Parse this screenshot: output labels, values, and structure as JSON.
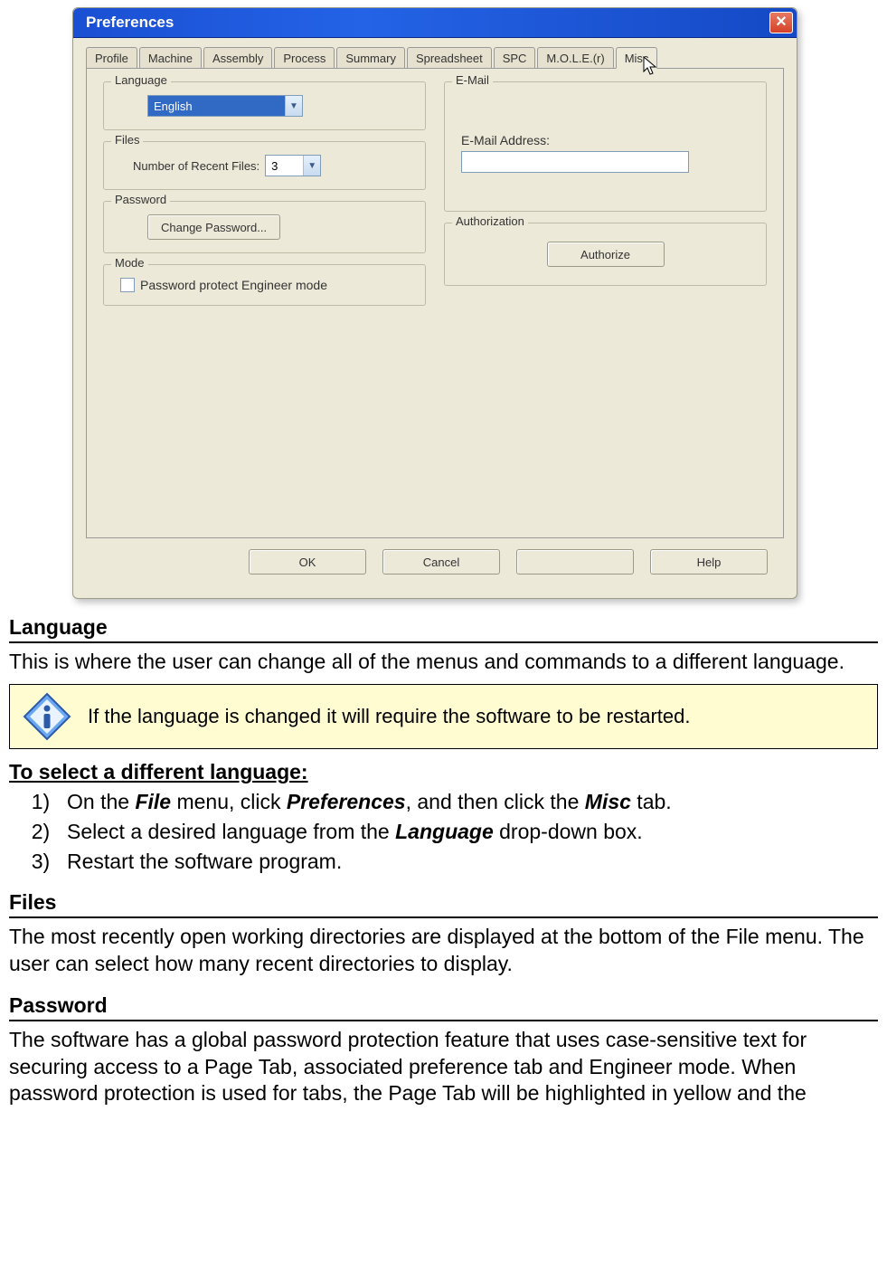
{
  "dialog": {
    "title": "Preferences",
    "tabs": [
      "Profile",
      "Machine",
      "Assembly",
      "Process",
      "Summary",
      "Spreadsheet",
      "SPC",
      "M.O.L.E.(r)",
      "Misc"
    ],
    "active_tab_index": 8,
    "language_group": "Language",
    "language_value": "English",
    "files_group": "Files",
    "files_label": "Number of Recent Files:",
    "files_value": "3",
    "password_group": "Password",
    "change_password_btn": "Change Password...",
    "mode_group": "Mode",
    "mode_checkbox_label": "Password protect Engineer mode",
    "email_group": "E-Mail",
    "email_label": "E-Mail Address:",
    "auth_group": "Authorization",
    "authorize_btn": "Authorize",
    "buttons": {
      "ok": "OK",
      "cancel": "Cancel",
      "apply": "",
      "help": "Help"
    }
  },
  "doc": {
    "h1": "Language",
    "p1": "This is where the user can change all of the menus and commands to a different language.",
    "note": "If the language is changed it will require the software to be restarted.",
    "proc_heading": "To select a different language:",
    "steps": {
      "s1a": "On the ",
      "s1b": "File",
      "s1c": " menu, click ",
      "s1d": "Preferences",
      "s1e": ", and then click the ",
      "s1f": "Misc",
      "s1g": " tab.",
      "s2a": "Select a desired language from the ",
      "s2b": "Language",
      "s2c": " drop-down box.",
      "s3": "Restart the software program."
    },
    "h2": "Files",
    "p2": "The most recently open working directories are displayed at the bottom of the File menu. The user can select how many recent directories to display.",
    "h3": "Password",
    "p3": "The software has a global password protection feature that uses case-sensitive text for securing access to a Page Tab, associated preference tab and Engineer mode. When password protection is used for tabs, the Page Tab will be highlighted in yellow and the"
  }
}
